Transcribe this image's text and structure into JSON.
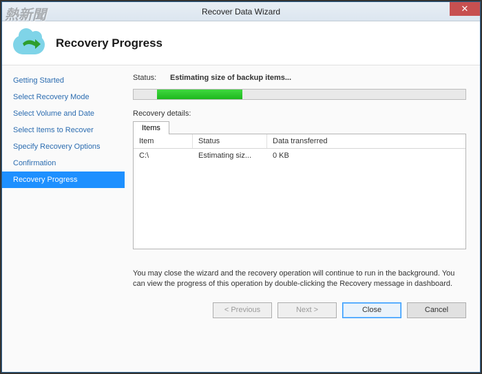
{
  "window": {
    "title": "Recover Data Wizard"
  },
  "header": {
    "title": "Recovery Progress"
  },
  "sidebar": {
    "items": [
      {
        "label": "Getting Started",
        "active": false
      },
      {
        "label": "Select Recovery Mode",
        "active": false
      },
      {
        "label": "Select Volume and Date",
        "active": false
      },
      {
        "label": "Select Items to Recover",
        "active": false
      },
      {
        "label": "Specify Recovery Options",
        "active": false
      },
      {
        "label": "Confirmation",
        "active": false
      },
      {
        "label": "Recovery Progress",
        "active": true
      }
    ]
  },
  "main": {
    "status_label": "Status:",
    "status_text": "Estimating size of backup items...",
    "details_label": "Recovery details:",
    "tab_label": "Items",
    "columns": {
      "item": "Item",
      "status": "Status",
      "data": "Data transferred"
    },
    "rows": [
      {
        "item": "C:\\",
        "status": "Estimating siz...",
        "data": "0 KB"
      }
    ],
    "note": "You may close the wizard and the recovery operation will continue to run in the background. You can view the progress of this operation by double-clicking the Recovery message in dashboard."
  },
  "buttons": {
    "previous": "< Previous",
    "next": "Next >",
    "close": "Close",
    "cancel": "Cancel"
  },
  "watermark": "熱新聞"
}
